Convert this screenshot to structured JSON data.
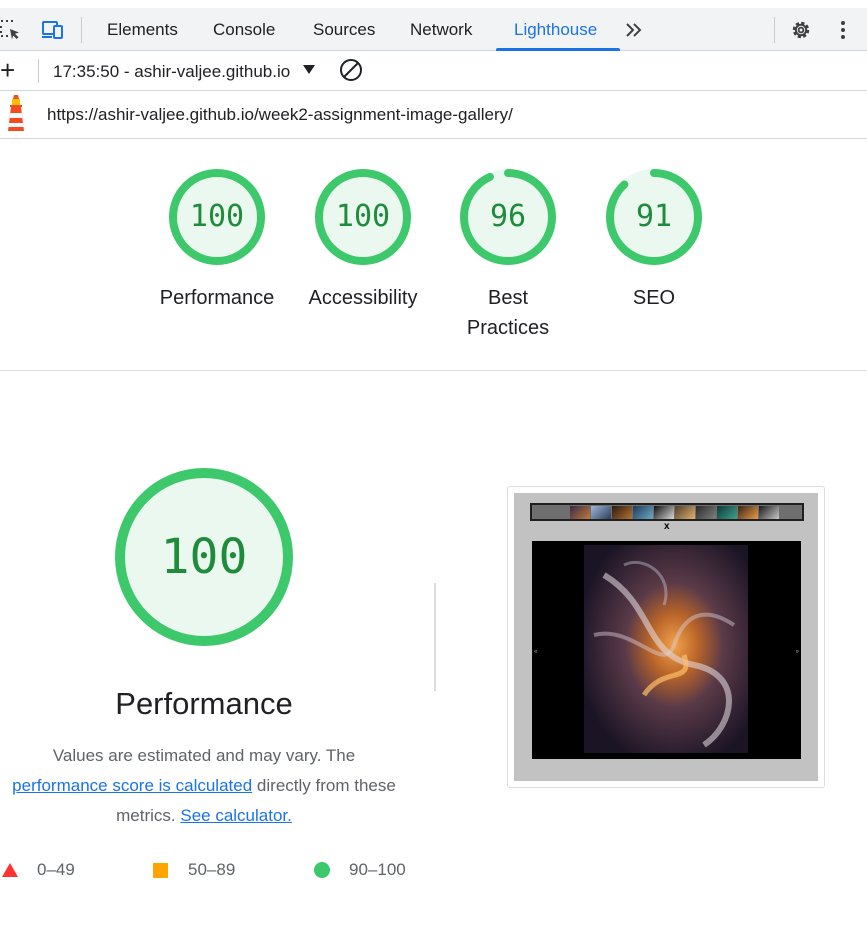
{
  "devtools": {
    "tabs": [
      {
        "label": "Elements"
      },
      {
        "label": "Console"
      },
      {
        "label": "Sources"
      },
      {
        "label": "Network"
      },
      {
        "label": "Lighthouse"
      }
    ],
    "active_tab": "Lighthouse",
    "more_tabs_icon": "chevron-double-right-icon",
    "accent_color": "#1a73e8"
  },
  "toolbar": {
    "report_select": "17:35:50 - ashir-valjee.github.io",
    "url": "https://ashir-valjee.github.io/week2-assignment-image-gallery/"
  },
  "summary": {
    "gauges": [
      {
        "label": "Performance",
        "score": "100",
        "score_value": 1.0
      },
      {
        "label": "Accessibility",
        "score": "100",
        "score_value": 1.0
      },
      {
        "label": "Best Practices",
        "score": "96",
        "score_value": 0.96
      },
      {
        "label": "SEO",
        "score": "91",
        "score_value": 0.91
      }
    ],
    "pass_color": "#0cce6b"
  },
  "performance": {
    "score": "100",
    "score_value": 1.0,
    "title": "Performance",
    "desc_prefix": "Values are estimated and may vary. The",
    "desc_link": "performance score is calculated",
    "desc_middle": "directly from these metrics.",
    "calculator_link": "See calculator."
  },
  "legend": [
    {
      "range": "0–49",
      "color": "#ff3333",
      "shape": "triangle"
    },
    {
      "range": "50–89",
      "color": "#ffa400",
      "shape": "square"
    },
    {
      "range": "90–100",
      "color": "#0cce6b",
      "shape": "circle"
    }
  ],
  "screenshot": {
    "close_label": "x",
    "prev_label": "«",
    "next_label": "»"
  }
}
